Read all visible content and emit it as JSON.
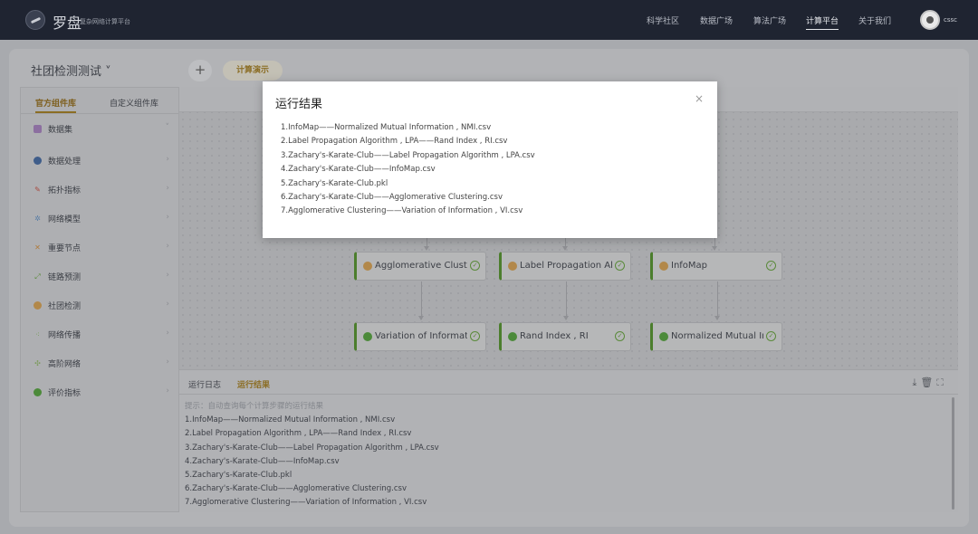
{
  "app": {
    "logo_text": "罗盘",
    "logo_subtitle": "复杂网络计算平台",
    "user_name": "cssc"
  },
  "nav": {
    "items": [
      {
        "label": "科学社区"
      },
      {
        "label": "数据广场"
      },
      {
        "label": "算法广场"
      },
      {
        "label": "计算平台",
        "active": true
      },
      {
        "label": "关于我们"
      }
    ]
  },
  "project": {
    "title": "社团检测测试 ˅",
    "add_label": "+",
    "tab_label": "计算演示"
  },
  "sidebar": {
    "tabs": [
      {
        "label": "官方组件库",
        "active": true
      },
      {
        "label": "自定义组件库"
      }
    ],
    "items": [
      {
        "label": "数据集",
        "icon": "dataset-icon",
        "chevron": "˅"
      },
      {
        "label": "数据处理",
        "icon": "data-processing-icon",
        "chevron": "›"
      },
      {
        "label": "拓扑指标",
        "icon": "topology-icon",
        "chevron": "›"
      },
      {
        "label": "网络模型",
        "icon": "network-model-icon",
        "chevron": "›"
      },
      {
        "label": "重要节点",
        "icon": "key-node-icon",
        "chevron": "›"
      },
      {
        "label": "链路预测",
        "icon": "link-prediction-icon",
        "chevron": "›"
      },
      {
        "label": "社团检测",
        "icon": "community-detection-icon",
        "chevron": "›"
      },
      {
        "label": "网络传播",
        "icon": "network-spread-icon",
        "chevron": "›"
      },
      {
        "label": "高阶网络",
        "icon": "high-order-icon",
        "chevron": "›"
      },
      {
        "label": "评价指标",
        "icon": "evaluation-icon",
        "chevron": "›"
      }
    ]
  },
  "workflow": {
    "nodes_row1": [
      {
        "label": "Agglomerative Cluster"
      },
      {
        "label": "Label Propagation Alg"
      },
      {
        "label": "InfoMap"
      }
    ],
    "nodes_row2": [
      {
        "label": "Variation of Informatic"
      },
      {
        "label": "Rand Index , RI"
      },
      {
        "label": "Normalized Mutual Inf"
      }
    ]
  },
  "bottom_panel": {
    "tabs": [
      {
        "label": "运行日志"
      },
      {
        "label": "运行结果",
        "active": true
      }
    ],
    "icons": [
      "download-icon",
      "delete-icon",
      "fullscreen-icon"
    ],
    "hint": "提示：自动查询每个计算步骤的运行结果",
    "results": [
      "1.InfoMap——Normalized Mutual Information , NMI.csv",
      "2.Label Propagation Algorithm , LPA——Rand Index , RI.csv",
      "3.Zachary's-Karate-Club——Label Propagation Algorithm , LPA.csv",
      "4.Zachary's-Karate-Club——InfoMap.csv",
      "5.Zachary's-Karate-Club.pkl",
      "6.Zachary's-Karate-Club——Agglomerative Clustering.csv",
      "7.Agglomerative Clustering——Variation of Information , VI.csv"
    ]
  },
  "modal": {
    "title": "运行结果",
    "close": "×",
    "items": [
      "1.InfoMap——Normalized Mutual Information , NMI.csv",
      "2.Label Propagation Algorithm , LPA——Rand Index , RI.csv",
      "3.Zachary's-Karate-Club——Label Propagation Algorithm , LPA.csv",
      "4.Zachary's-Karate-Club——InfoMap.csv",
      "5.Zachary's-Karate-Club.pkl",
      "6.Zachary's-Karate-Club——Agglomerative Clustering.csv",
      "7.Agglomerative Clustering——Variation of Information , VI.csv"
    ]
  },
  "colors": {
    "accent": "#8b6d24",
    "node_border": "#4c7e2d",
    "topbar": "#1f2431"
  }
}
